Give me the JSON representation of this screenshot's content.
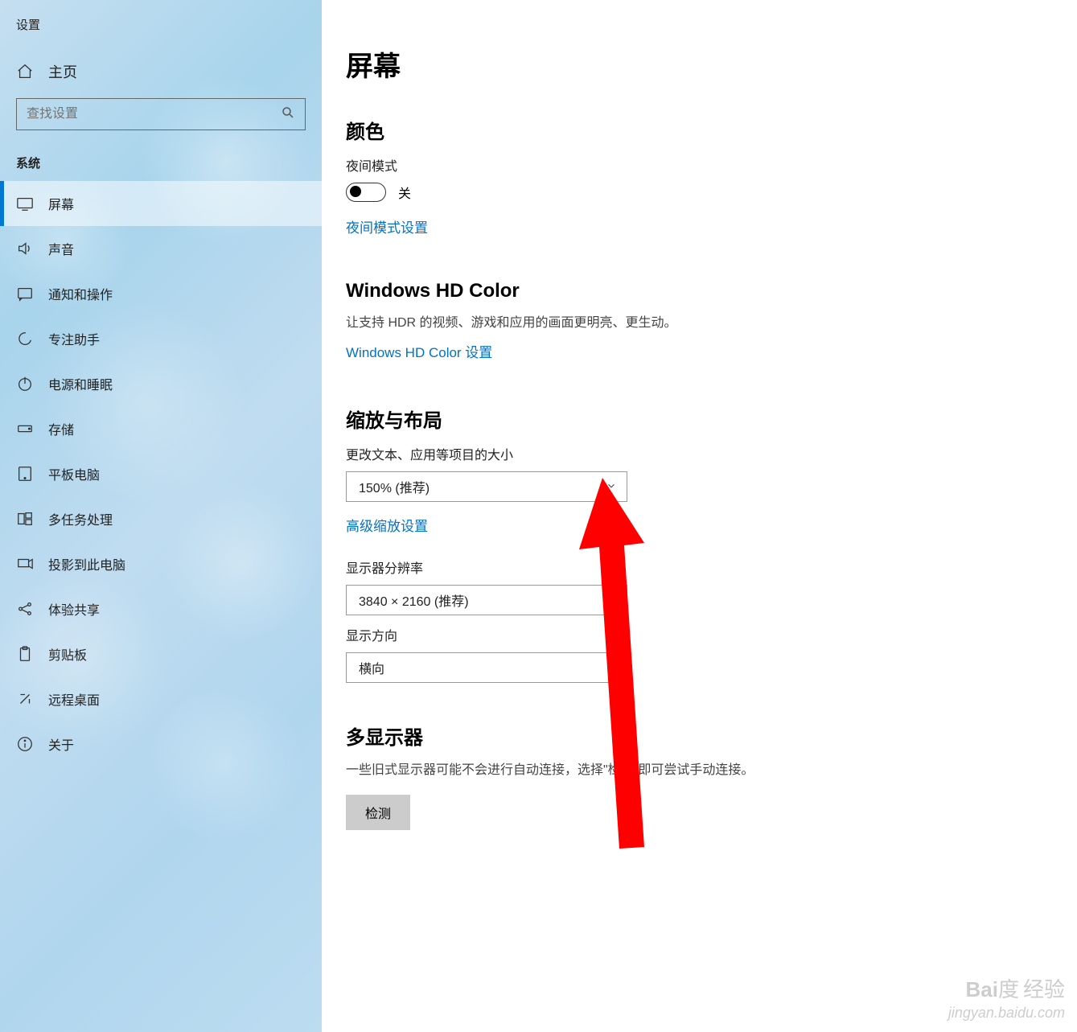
{
  "window": {
    "title": "设置"
  },
  "sidebar": {
    "home": "主页",
    "search_placeholder": "查找设置",
    "category": "系统",
    "items": [
      {
        "label": "屏幕"
      },
      {
        "label": "声音"
      },
      {
        "label": "通知和操作"
      },
      {
        "label": "专注助手"
      },
      {
        "label": "电源和睡眠"
      },
      {
        "label": "存储"
      },
      {
        "label": "平板电脑"
      },
      {
        "label": "多任务处理"
      },
      {
        "label": "投影到此电脑"
      },
      {
        "label": "体验共享"
      },
      {
        "label": "剪贴板"
      },
      {
        "label": "远程桌面"
      },
      {
        "label": "关于"
      }
    ]
  },
  "main": {
    "title": "屏幕",
    "color": {
      "title": "颜色",
      "night_label": "夜间模式",
      "toggle_state": "关",
      "night_link": "夜间模式设置"
    },
    "hdcolor": {
      "title": "Windows HD Color",
      "desc": "让支持 HDR 的视频、游戏和应用的画面更明亮、更生动。",
      "link": "Windows HD Color 设置"
    },
    "scale": {
      "title": "缩放与布局",
      "size_label": "更改文本、应用等项目的大小",
      "size_value": "150% (推荐)",
      "adv_link": "高级缩放设置",
      "res_label": "显示器分辨率",
      "res_value": "3840 × 2160 (推荐)",
      "orient_label": "显示方向",
      "orient_value": "横向"
    },
    "multi": {
      "title": "多显示器",
      "desc": "一些旧式显示器可能不会进行自动连接，选择\"检测\"即可尝试手动连接。",
      "btn": "检测"
    }
  },
  "watermark": {
    "brand": "Bai",
    "brand2": "度",
    "brand3": "经验",
    "url": "jingyan.baidu.com"
  }
}
